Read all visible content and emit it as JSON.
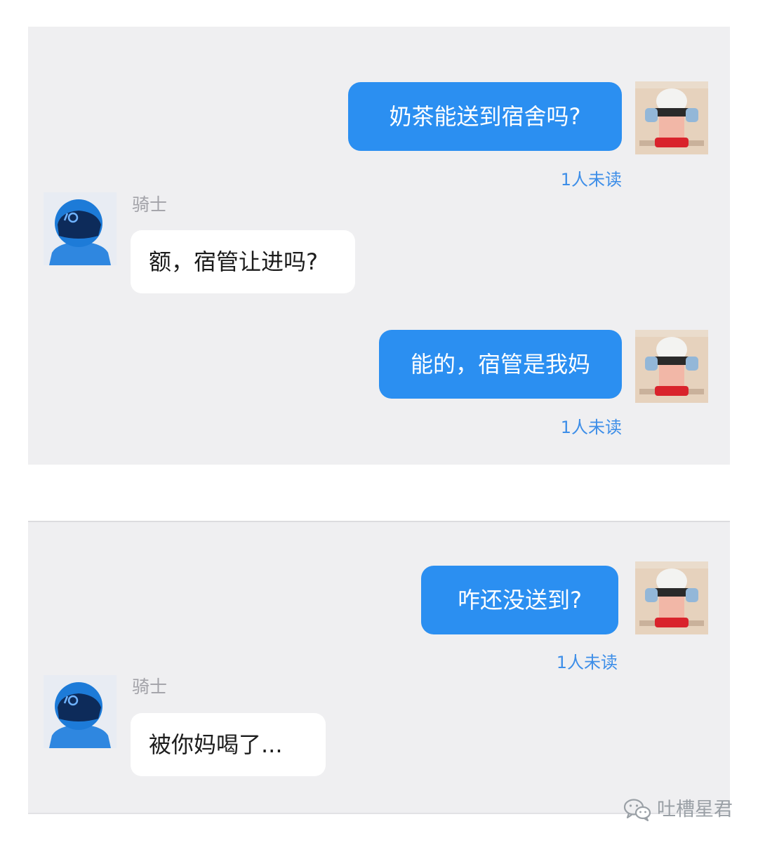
{
  "screenshots": [
    {
      "messages": [
        {
          "direction": "outgoing",
          "text": "奶茶能送到宿舍吗?",
          "status": "1人未读"
        },
        {
          "direction": "incoming",
          "sender": "骑士",
          "text": "额，宿管让进吗?"
        },
        {
          "direction": "outgoing",
          "text": "能的，宿管是我妈",
          "status": "1人未读"
        }
      ]
    },
    {
      "messages": [
        {
          "direction": "outgoing",
          "text": "咋还没送到?",
          "status": "1人未读"
        },
        {
          "direction": "incoming",
          "sender": "骑士",
          "text": "被你妈喝了..."
        }
      ]
    }
  ],
  "icons": {
    "user_avatar": "cartoon-user-avatar-icon",
    "rider_avatar": "rider-helmet-avatar-icon",
    "watermark": "wechat-icon"
  },
  "watermark": {
    "text": "吐槽星君"
  },
  "colors": {
    "outgoing_bubble": "#2b8ff1",
    "incoming_bubble": "#ffffff",
    "panel_background": "#efeff1",
    "read_status": "#3d8ee8",
    "sender_name": "#a2a2a8"
  }
}
